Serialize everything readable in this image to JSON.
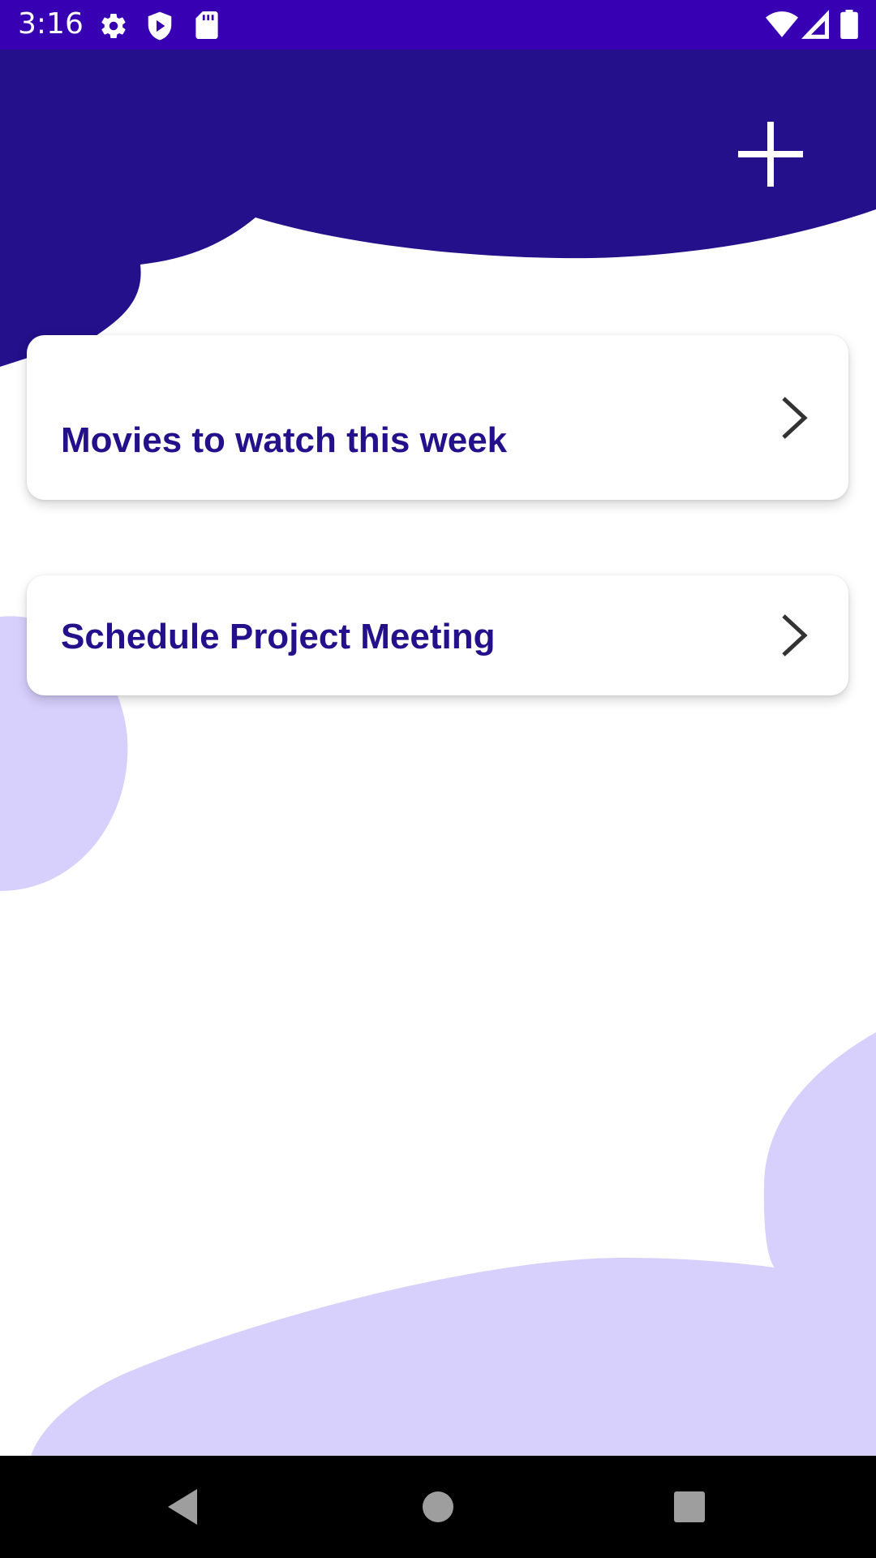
{
  "status_bar": {
    "time": "3:16",
    "icons": [
      "settings-icon",
      "play-protect-icon",
      "sd-card-icon",
      "wifi-icon",
      "signal-icon",
      "battery-icon"
    ]
  },
  "header": {
    "add_button_icon": "plus-icon"
  },
  "lists": [
    {
      "title": "Movies to watch this week",
      "icon": "chevron-right-icon"
    },
    {
      "title": "Schedule Project Meeting",
      "icon": "chevron-right-icon"
    }
  ],
  "nav_bar": {
    "icons": [
      "back-icon",
      "home-icon",
      "recents-icon"
    ]
  },
  "colors": {
    "status_bar": "#3700b3",
    "header": "#23108a",
    "title_text": "#23108a",
    "blob_light": "#d7cffc",
    "card": "#ffffff",
    "nav_bar": "#000000"
  }
}
